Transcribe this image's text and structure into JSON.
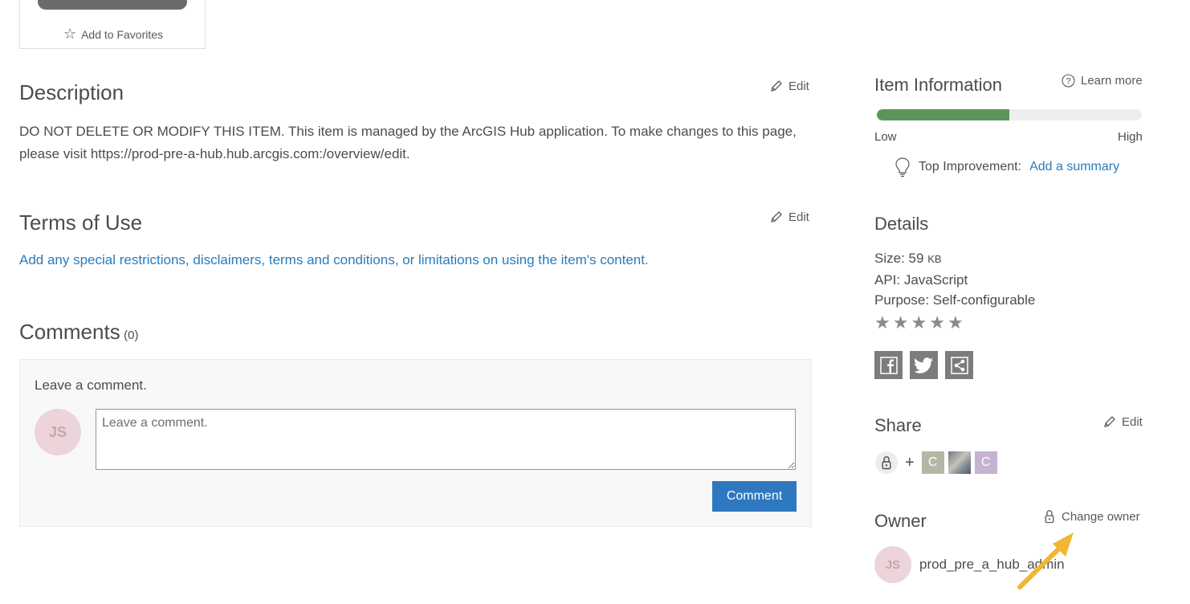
{
  "favorites": {
    "label": "Add to Favorites"
  },
  "description": {
    "title": "Description",
    "edit_label": "Edit",
    "text": "DO NOT DELETE OR MODIFY THIS ITEM. This item is managed by the ArcGIS Hub application. To make changes to this page, please visit https://prod-pre-a-hub.hub.arcgis.com:/overview/edit."
  },
  "terms": {
    "title": "Terms of Use",
    "edit_label": "Edit",
    "placeholder_link": "Add any special restrictions, disclaimers, terms and conditions, or limitations on using the item's content."
  },
  "comments": {
    "title": "Comments",
    "count": "(0)",
    "prompt": "Leave a comment.",
    "avatar_initials": "JS",
    "input_placeholder": "Leave a comment.",
    "input_value": "",
    "submit_label": "Comment"
  },
  "item_info": {
    "title": "Item Information",
    "learn_more": "Learn more",
    "score_fraction": 0.5,
    "low_label": "Low",
    "high_label": "High",
    "top_improvement_label": "Top Improvement:",
    "top_improvement_link": "Add a summary"
  },
  "details": {
    "title": "Details",
    "size_label": "Size:",
    "size_value": "59",
    "size_unit": "KB",
    "api_label": "API:",
    "api_value": "JavaScript",
    "purpose_label": "Purpose:",
    "purpose_value": "Self-configurable",
    "rating": 0,
    "rating_max": 5
  },
  "share": {
    "title": "Share",
    "edit_label": "Edit",
    "plus": "+",
    "groups": [
      {
        "initial": "C",
        "color": "#b3b8a6"
      },
      {
        "initial": "",
        "color": "#8a8f96"
      },
      {
        "initial": "C",
        "color": "#c5b3cf"
      }
    ]
  },
  "owner": {
    "title": "Owner",
    "change_owner": "Change owner",
    "avatar_initials": "JS",
    "username": "prod_pre_a_hub_admin"
  },
  "colors": {
    "accent": "#2b7bba",
    "button": "#2e78bf",
    "meter": "#5b955b",
    "arrow": "#f2b632"
  }
}
